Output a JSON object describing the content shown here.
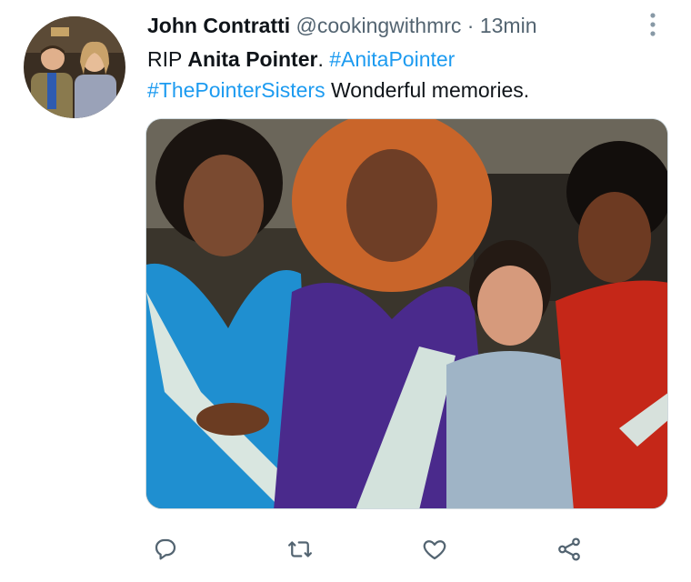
{
  "tweet": {
    "author": {
      "display_name": "John Contratti",
      "handle": "@cookingwithmrc",
      "separator": "·",
      "timestamp": "13min",
      "avatar_icon": "profile-photo"
    },
    "text": {
      "line1_prefix": "RIP ",
      "line1_bold": "Anita Pointer",
      "line1_mid": ". ",
      "hashtag1": "#AnitaPointer",
      "hashtag2": "#ThePointerSisters",
      "line2_suffix": " Wonderful memories."
    },
    "media": {
      "type": "photo"
    },
    "actions": [
      {
        "name": "reply",
        "icon": "reply-icon"
      },
      {
        "name": "retweet",
        "icon": "retweet-icon"
      },
      {
        "name": "like",
        "icon": "heart-icon"
      },
      {
        "name": "share",
        "icon": "share-icon"
      }
    ],
    "colors": {
      "text": "#0f1419",
      "secondary": "#536471",
      "link": "#1d9bf0"
    }
  }
}
